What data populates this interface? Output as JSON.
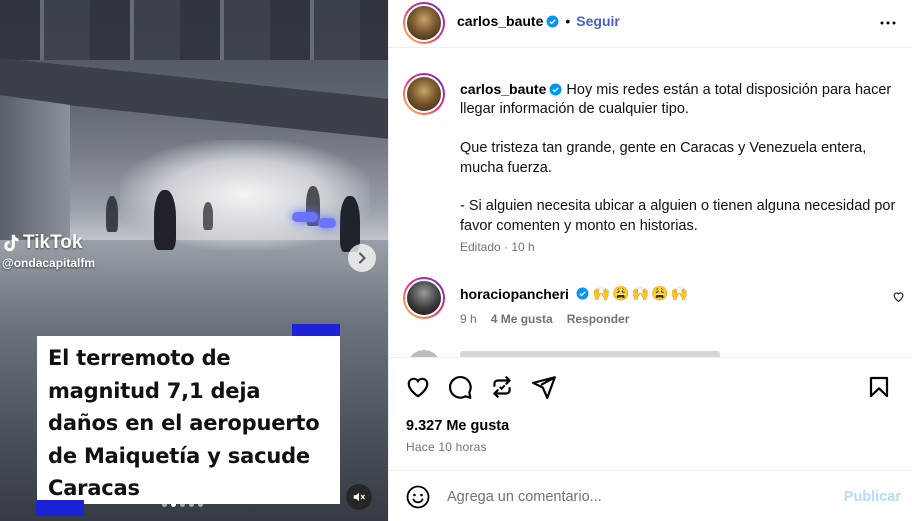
{
  "media": {
    "watermark_brand": "TikTok",
    "watermark_handle": "@ondacapitalfm",
    "headline_lines": [
      "El terremoto de",
      "magnitud 7,1 deja",
      "daños en el aeropuerto",
      "de Maiquetía y sacude",
      "Caracas"
    ],
    "carousel_dots": 5,
    "active_dot": 1,
    "accent_color": "#1b23d6"
  },
  "header": {
    "username": "carlos_baute",
    "separator": "•",
    "follow_label": "Seguir"
  },
  "caption": {
    "username": "carlos_baute",
    "paragraphs": [
      "Hoy mis redes están a total disposición para hacer llegar información de cualquier tipo.",
      "Que tristeza tan grande, gente en Caracas y Venezuela entera, mucha fuerza.",
      "- Si alguien necesita ubicar a alguien o tienen alguna necesidad por favor comenten y monto en historias."
    ],
    "edited_label": "Editado",
    "time": "10 h"
  },
  "comment": {
    "username": "horaciopancheri",
    "emoji": "🙌😩🙌😩🙌",
    "time": "9 h",
    "likes": "4 Me gusta",
    "reply_label": "Responder"
  },
  "post": {
    "likes": "9.327 Me gusta",
    "timestamp": "Hace 10 horas"
  },
  "composer": {
    "placeholder": "Agrega un comentario...",
    "post_label": "Publicar"
  },
  "colors": {
    "link": "#4a5bd4",
    "verified": "#0095f6",
    "muted_text": "#737373",
    "post_disabled": "#b3dbff"
  }
}
